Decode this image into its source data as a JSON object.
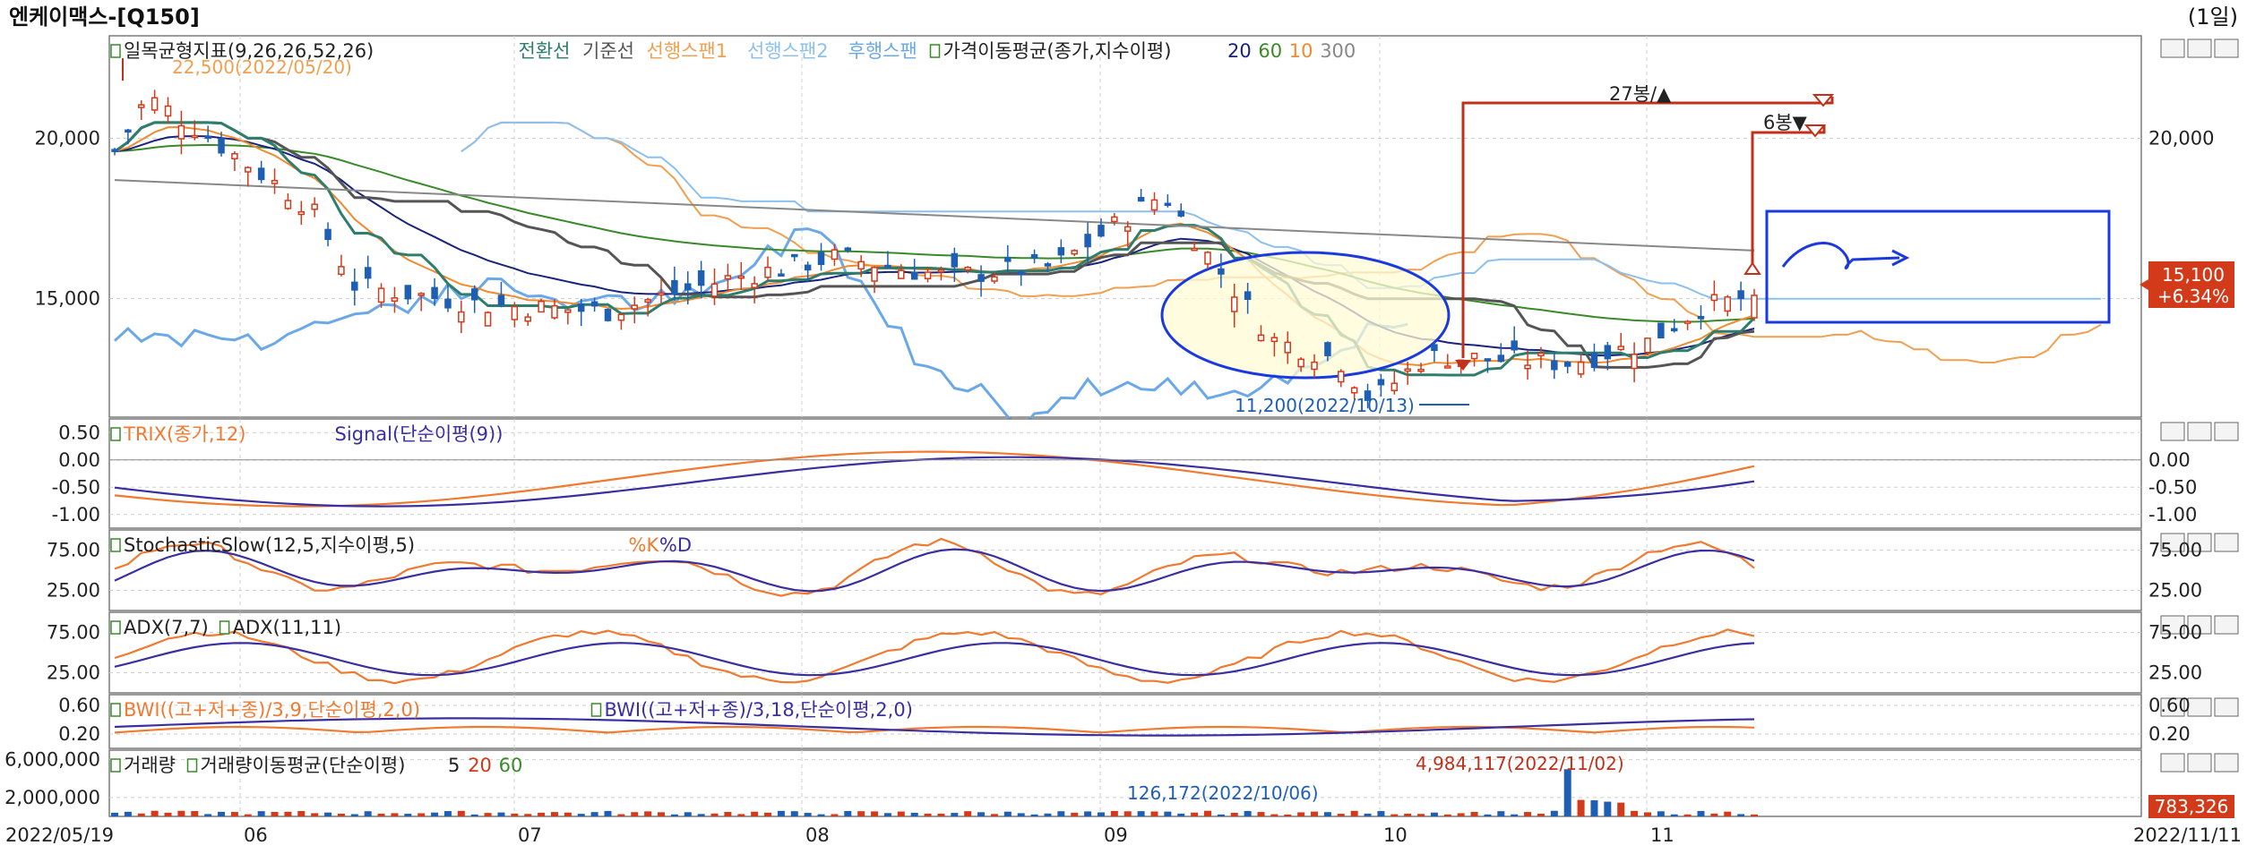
{
  "window": {
    "title": "엔케이맥스-[Q150]",
    "period": "(1일)"
  },
  "colors": {
    "up": "#d23a1a",
    "down": "#1f5fb3",
    "grid": "#cfcfcf",
    "frame": "#7a7a7a",
    "conv": "#2e7d6d",
    "base": "#555555",
    "spanA": "#f0a050",
    "spanB": "#8cc0ee",
    "lagging": "#6aa8e8",
    "ma20": "#1a237e",
    "ma60": "#3a8a2a",
    "ma10": "#f08a30",
    "ma300": "#888888",
    "trix": "#f07a30",
    "signal": "#3a2fa0",
    "pricebadge": "#d23a1a",
    "annot": "#c0301a",
    "box": "#1a3adf",
    "ellipse_fill": "#fffbd6"
  },
  "panels": {
    "price": {
      "legend": [
        {
          "text": "일목균형지표(9,26,26,52,26)",
          "color": "#222222"
        },
        {
          "text": "전환선",
          "color": "#2e7d6d"
        },
        {
          "text": "기준선",
          "color": "#555555"
        },
        {
          "text": "선행스팬1",
          "color": "#f0a050"
        },
        {
          "text": "선행스팬2",
          "color": "#8cc0ee"
        },
        {
          "text": "후행스팬",
          "color": "#6aa8e8"
        },
        {
          "text": "가격이동평균(종가,지수이평)",
          "color": "#222222"
        },
        {
          "text": "20",
          "color": "#1a237e"
        },
        {
          "text": "60",
          "color": "#3a8a2a"
        },
        {
          "text": "10",
          "color": "#f08a30"
        },
        {
          "text": "300",
          "color": "#888888"
        }
      ],
      "y_ticks": [
        "20,000",
        "15,000"
      ],
      "y_ticks_right": [
        "20,000"
      ],
      "high_label": "22,500(2022/05/20)",
      "low_label": "11,200(2022/10/13)",
      "bars27": "27봉/▲",
      "bars6": "6봉▼",
      "last_price": "15,100",
      "last_change": "+6.34%"
    },
    "trix": {
      "legend": [
        {
          "text": "TRIX(종가,12)",
          "color": "#f07a30"
        },
        {
          "text": "Signal(단순이평(9))",
          "color": "#3a2fa0"
        }
      ],
      "y_ticks": [
        "0.50",
        "0.00",
        "-0.50",
        "-1.00"
      ],
      "y_ticks_right": [
        "0.00",
        "-0.50",
        "-1.00"
      ]
    },
    "stoch": {
      "legend": [
        {
          "text": "StochasticSlow(12,5,지수이평,5)",
          "color": "#222222"
        },
        {
          "text": "%K",
          "color": "#f07a30"
        },
        {
          "text": "%D",
          "color": "#3a2fa0"
        }
      ],
      "y_ticks": [
        "75.00",
        "25.00"
      ],
      "y_ticks_right": [
        "75.00",
        "25.00"
      ]
    },
    "adx": {
      "legend": [
        {
          "text": "ADX(7,7)",
          "color": "#222222"
        },
        {
          "text": "ADX(11,11)",
          "color": "#222222"
        }
      ],
      "y_ticks": [
        "75.00",
        "25.00"
      ],
      "y_ticks_right": [
        "75.00",
        "25.00"
      ]
    },
    "bwi": {
      "legend": [
        {
          "text": "BWI((고+저+종)/3,9,단순이평,2,0)",
          "color": "#f07a30"
        },
        {
          "text": "BWI((고+저+종)/3,18,단순이평,2,0)",
          "color": "#3a2fa0"
        }
      ],
      "y_ticks": [
        "0.60",
        "0.20"
      ],
      "y_ticks_right": [
        "0.60",
        "0.20"
      ]
    },
    "volume": {
      "legend": [
        {
          "text": "거래량",
          "color": "#222222"
        },
        {
          "text": "거래량이동평균(단순이평)",
          "color": "#222222"
        },
        {
          "text": "5",
          "color": "#222222"
        },
        {
          "text": "20",
          "color": "#d23a1a"
        },
        {
          "text": "60",
          "color": "#3a8a2a"
        }
      ],
      "y_ticks": [
        "6,000,000",
        "2,000,000"
      ],
      "ann1": "126,172(2022/10/06)",
      "ann2": "4,984,117(2022/11/02)",
      "last_volume": "783,326"
    }
  },
  "x_axis": {
    "start": "2022/05/19",
    "end": "2022/11/11",
    "months": [
      "06",
      "07",
      "08",
      "09",
      "10",
      "11"
    ]
  },
  "chart_data": [
    {
      "type": "candlestick",
      "x_start": "2022/05/19",
      "x_end": "2022/11/11",
      "ylim": [
        11000,
        23000
      ],
      "annotations": [
        {
          "label": "22,500(2022/05/20)",
          "value": 22500,
          "date": "2022/05/20"
        },
        {
          "label": "11,200(2022/10/13)",
          "value": 11200,
          "date": "2022/10/13"
        }
      ],
      "last_close": 15100,
      "last_change_pct": 6.34
    },
    {
      "type": "line",
      "series": [
        {
          "name": "TRIX(종가,12)"
        },
        {
          "name": "Signal(단순이평(9))"
        }
      ],
      "ylim": [
        -1.2,
        0.7
      ]
    },
    {
      "type": "line",
      "series": [
        {
          "name": "%K"
        },
        {
          "name": "%D"
        }
      ],
      "ylim": [
        0,
        100
      ]
    },
    {
      "type": "line",
      "series": [
        {
          "name": "ADX(7,7)"
        },
        {
          "name": "ADX(11,11)"
        }
      ],
      "ylim": [
        0,
        100
      ]
    },
    {
      "type": "line",
      "series": [
        {
          "name": "BWI((고+저+종)/3,9,단순이평,2,0)"
        },
        {
          "name": "BWI((고+저+종)/3,18,단순이평,2,0)"
        }
      ],
      "ylim": [
        0,
        0.75
      ]
    },
    {
      "type": "bar",
      "series": [
        {
          "name": "거래량"
        }
      ],
      "ylim": [
        0,
        7000000
      ],
      "annotations": [
        {
          "label": "126,172(2022/10/06)",
          "value": 126172,
          "date": "2022/10/06"
        },
        {
          "label": "4,984,117(2022/11/02)",
          "value": 4984117,
          "date": "2022/11/02"
        }
      ],
      "last_volume": 783326
    }
  ]
}
